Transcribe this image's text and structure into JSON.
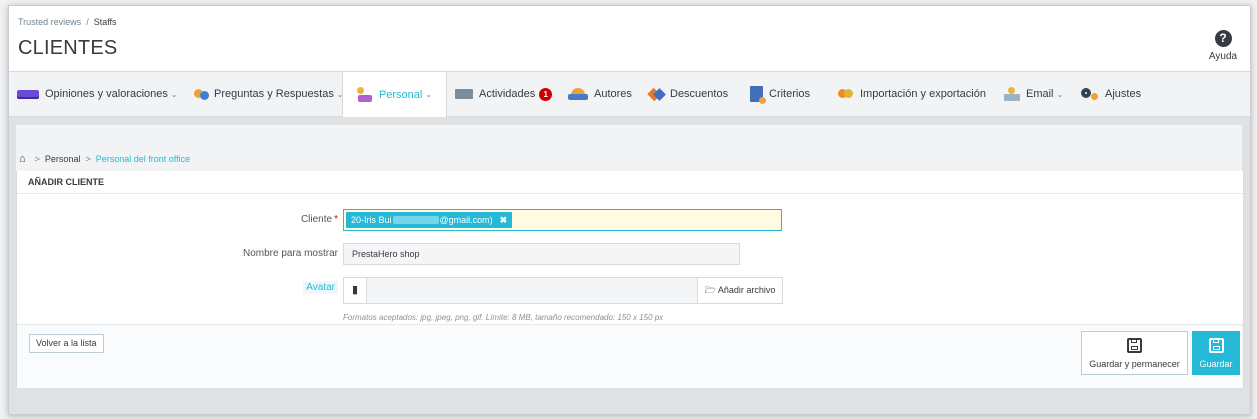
{
  "header": {
    "breadcrumb": [
      "Trusted reviews",
      "Staffs"
    ],
    "breadcrumb_separator": "/",
    "title": "CLIENTES",
    "help_label": "Ayuda"
  },
  "tabs": [
    {
      "label": "Opiniones y valoraciones",
      "icon": "keyboard-icon",
      "dropdown": true
    },
    {
      "label": "Preguntas y Respuestas",
      "icon": "qa-icon",
      "dropdown": true
    },
    {
      "label": "Personal",
      "icon": "person-icon",
      "dropdown": true,
      "active": true
    },
    {
      "label": "Actividades",
      "icon": "screen-icon",
      "badge": "1"
    },
    {
      "label": "Autores",
      "icon": "group-icon"
    },
    {
      "label": "Descuentos",
      "icon": "tag-icon"
    },
    {
      "label": "Criterios",
      "icon": "document-icon"
    },
    {
      "label": "Importación y exportación",
      "icon": "sync-icon"
    },
    {
      "label": "Email",
      "icon": "mail-icon",
      "dropdown": true
    },
    {
      "label": "Ajustes",
      "icon": "gears-icon"
    }
  ],
  "sub_breadcrumb": {
    "home_icon": "home-icon",
    "items": [
      "Personal",
      "Personal del front office"
    ]
  },
  "form": {
    "heading": "AÑADIR CLIENTE",
    "customer_label": "Cliente",
    "customer_required": "*",
    "customer_chip_prefix": "20-Iris Bui",
    "customer_chip_suffix": "@gmail.com)",
    "display_name_label": "Nombre para mostrar",
    "display_name_value": "PrestaHero shop",
    "avatar_label": "Avatar",
    "add_file_label": "Añadir archivo",
    "avatar_hint": "Formatos aceptados: jpg, jpeg, png, gif. Límite: 8 MB, tamaño recomendado: 150 x 150 px"
  },
  "footer": {
    "back_label": "Volver a la lista",
    "save_stay_label": "Guardar y permanecer",
    "save_label": "Guardar"
  },
  "colors": {
    "accent": "#25b9d7",
    "badge": "#cc0000",
    "active_tab_text": "#25b9d7"
  }
}
